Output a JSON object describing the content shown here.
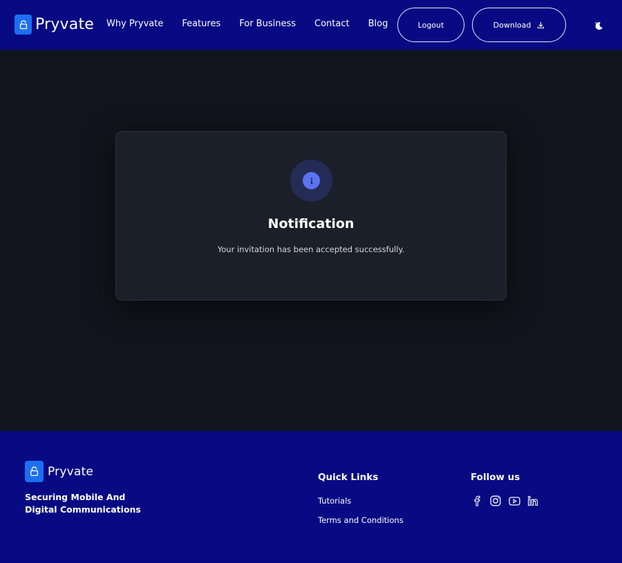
{
  "header": {
    "brand": "Pryvate",
    "nav": [
      "Why Pryvate",
      "Features",
      "For Business",
      "Contact",
      "Blog"
    ],
    "logout_label": "Logout",
    "download_label": "Download"
  },
  "notification": {
    "title": "Notification",
    "message": "Your invitation has been accepted successfully."
  },
  "footer": {
    "brand": "Pryvate",
    "tagline_line1": "Securing Mobile And",
    "tagline_line2": "Digital Communications",
    "quick_links_heading": "Quick Links",
    "links": [
      "Tutorials",
      "Terms and Conditions"
    ],
    "follow_heading": "Follow us",
    "social_icons": [
      "facebook-icon",
      "instagram-icon",
      "youtube-icon",
      "linkedin-icon"
    ]
  },
  "colors": {
    "header_bg": "#070a82",
    "main_bg": "#11141c",
    "card_bg": "#1b1f29",
    "accent": "#5b73f0",
    "logo_bg": "#1c6ff0"
  }
}
